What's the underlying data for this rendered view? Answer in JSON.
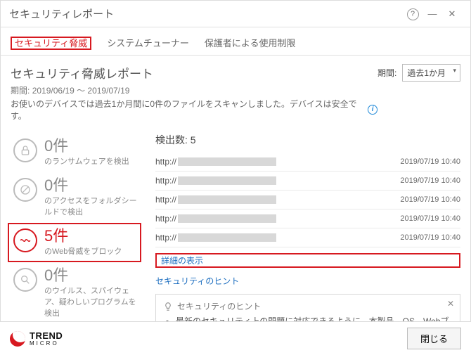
{
  "window": {
    "title": "セキュリティレポート"
  },
  "tabs": {
    "security": "セキュリティ脅威",
    "tuner": "システムチューナー",
    "parental": "保護者による使用制限"
  },
  "report": {
    "title": "セキュリティ脅威レポート",
    "period_label": "期間:",
    "period_range": "2019/06/19 ～ 2019/07/19",
    "scan_summary": "お使いのデバイスでは過去1か月間に0件のファイルをスキャンしました。デバイスは安全です。",
    "period_select_label": "期間:",
    "period_select_value": "過去1か月"
  },
  "cards": {
    "ransom": {
      "count": "0件",
      "desc": "のランサムウェアを検出"
    },
    "folder": {
      "count": "0件",
      "desc": "のアクセスをフォルダシールドで検出"
    },
    "web": {
      "count": "5件",
      "desc": "のWeb脅威をブロック"
    },
    "virus": {
      "count": "0件",
      "desc": "のウイルス、スパイウェア、疑わしいプログラムを検出"
    }
  },
  "detections": {
    "heading": "検出数: 5",
    "items": [
      {
        "url": "http://",
        "time": "2019/07/19 10:40"
      },
      {
        "url": "http://",
        "time": "2019/07/19 10:40"
      },
      {
        "url": "http://",
        "time": "2019/07/19 10:40"
      },
      {
        "url": "http://",
        "time": "2019/07/19 10:40"
      },
      {
        "url": "http://",
        "time": "2019/07/19 10:40"
      }
    ],
    "show_more": "詳細の表示",
    "hint_link": "セキュリティのヒント"
  },
  "hint_box": {
    "title": "セキュリティのヒント",
    "body": "最新のセキュリティ上の問題に対応できるように、本製品、OS、Webブラウザ、PDFリーダーなどのアプリケー"
  },
  "footer": {
    "brand1": "TREND",
    "brand2": "MICRO",
    "close": "閉じる"
  }
}
